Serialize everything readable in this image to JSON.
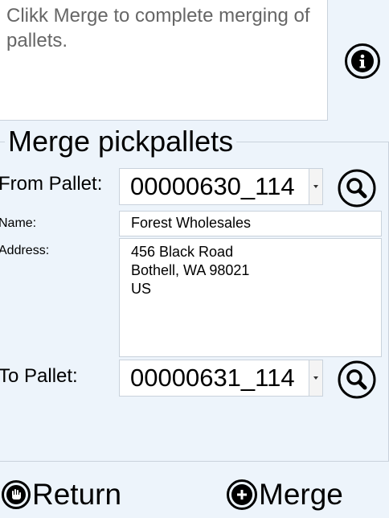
{
  "message": "Clikk Merge to complete merging of pallets.",
  "panel_title": "Merge pickpallets",
  "from_pallet": {
    "label": "From Pallet:",
    "value": "00000630_114"
  },
  "name": {
    "label": "Name:",
    "value": "Forest Wholesales"
  },
  "address": {
    "label": "Address:",
    "lines": [
      "456 Black Road",
      "Bothell, WA 98021",
      "US"
    ]
  },
  "to_pallet": {
    "label": "To Pallet:",
    "value": "00000631_114"
  },
  "buttons": {
    "return": "Return",
    "merge": "Merge"
  },
  "icons": {
    "info": "info-icon",
    "search": "magnifier-icon",
    "return": "hand-stop-icon",
    "merge": "plus-icon",
    "dropdown": "chevron-down-icon"
  }
}
